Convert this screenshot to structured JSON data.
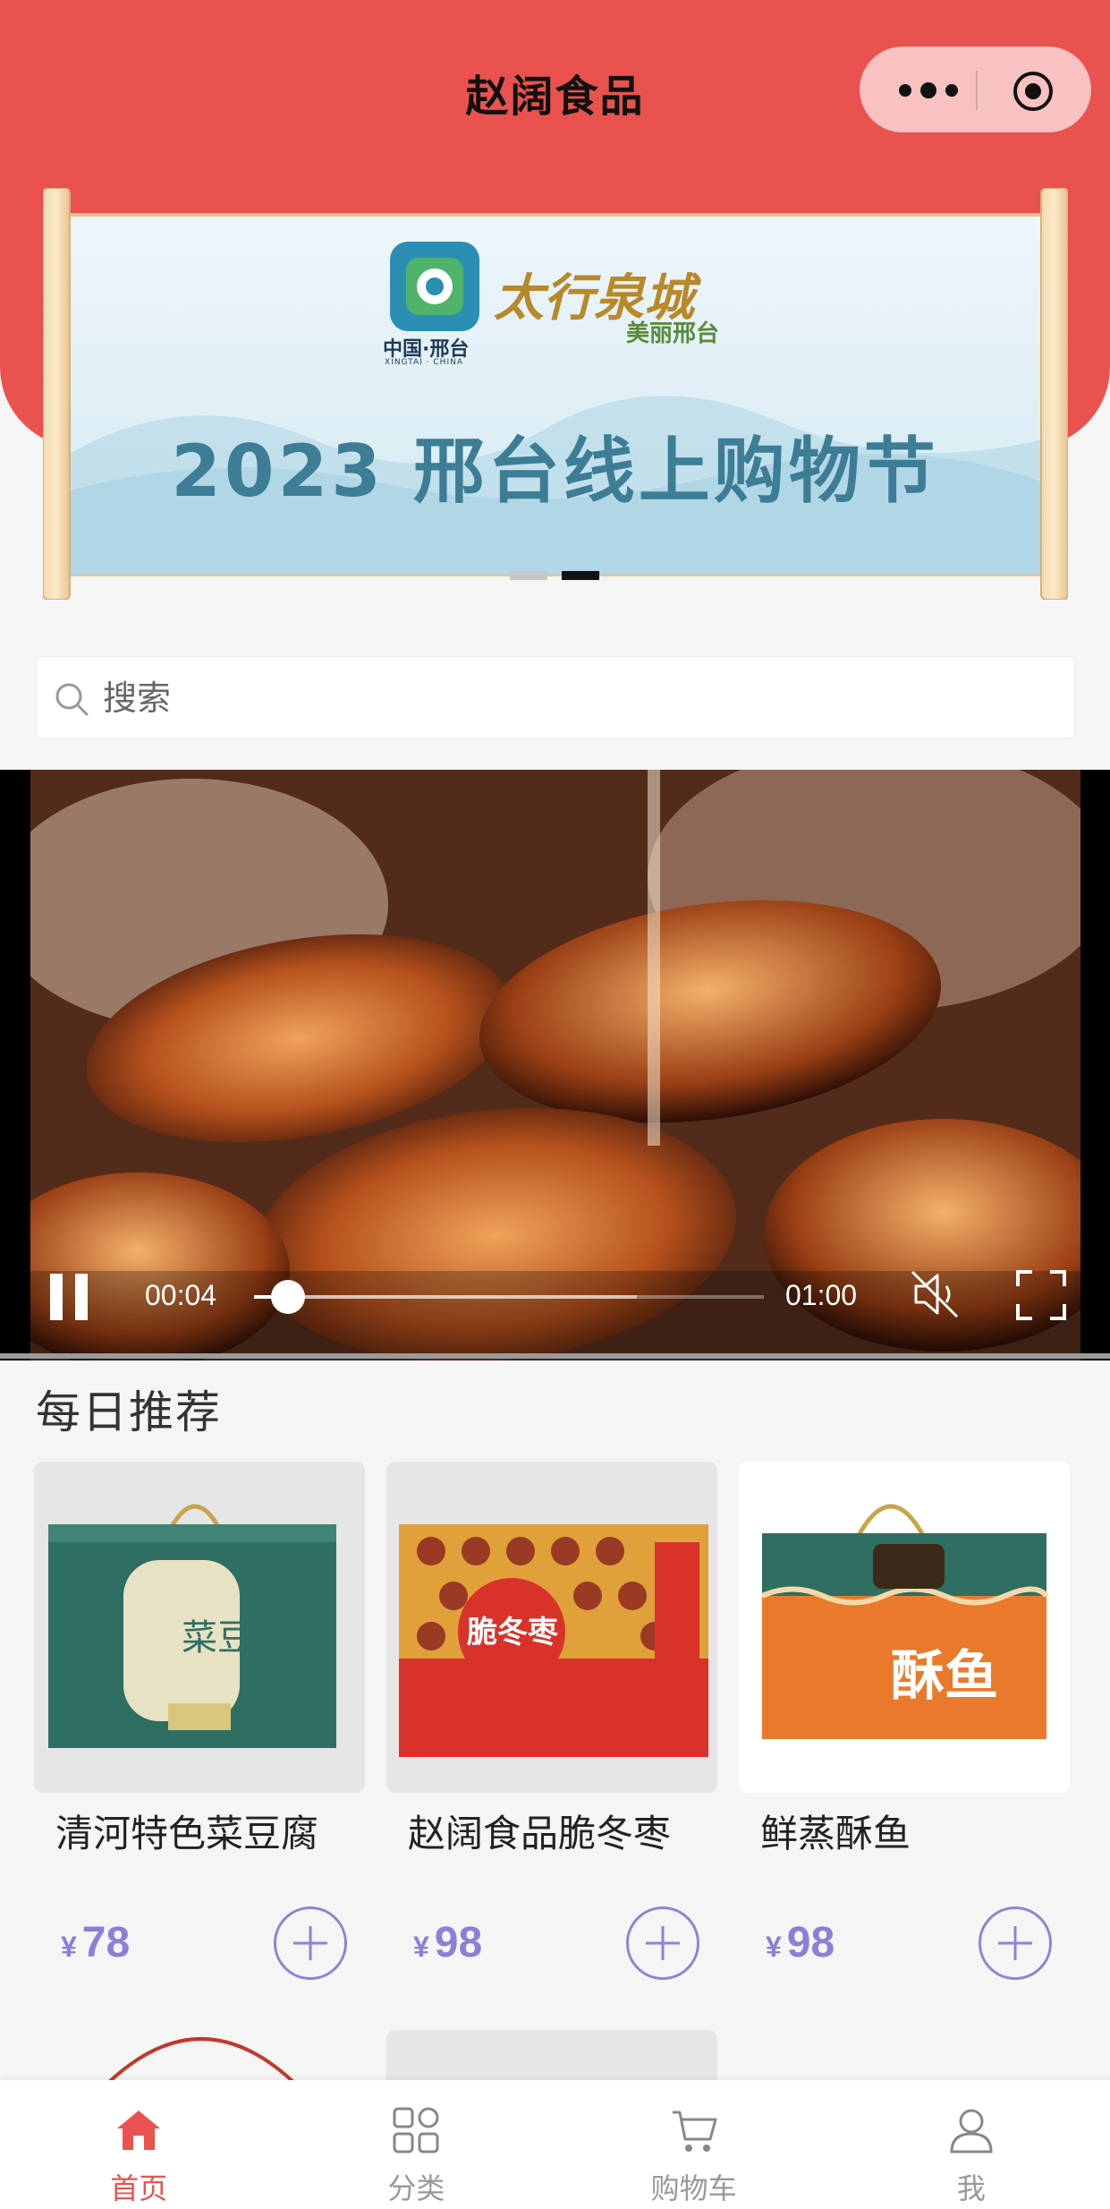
{
  "header": {
    "title": "赵阔食品",
    "color": "#e9524f"
  },
  "banner": {
    "logo_caption": "中国·邢台",
    "logo_caption_pinyin": "XINGTAI · CHINA",
    "slogan_main": "太行泉城",
    "slogan_sub": "美丽邢台",
    "headline": "2023 邢台线上购物节",
    "dots": 2,
    "active_dot": 1
  },
  "search": {
    "placeholder": "搜索"
  },
  "video": {
    "current_time": "00:04",
    "duration": "01:00",
    "progress": 0.067,
    "buffered": 0.75,
    "state": "playing",
    "muted": true
  },
  "daily": {
    "title": "每日推荐",
    "products": [
      {
        "name": "清河特色菜豆腐",
        "currency": "¥",
        "price": "78",
        "box_color": "#2f6e63",
        "box_text": "菜豆腐"
      },
      {
        "name": "赵阔食品脆冬枣",
        "currency": "¥",
        "price": "98",
        "box_color": "#d9322b",
        "box_text": "脆冬枣"
      },
      {
        "name": "鲜蒸酥鱼",
        "currency": "¥",
        "price": "98",
        "box_color": "#e97a2c",
        "box_text": "酥鱼"
      }
    ]
  },
  "tabbar": {
    "items": [
      {
        "label": "首页",
        "icon": "home-icon",
        "active": true
      },
      {
        "label": "分类",
        "icon": "category-icon",
        "active": false
      },
      {
        "label": "购物车",
        "icon": "cart-icon",
        "active": false
      },
      {
        "label": "我",
        "icon": "user-icon",
        "active": false
      }
    ],
    "active_color": "#e9524f"
  }
}
